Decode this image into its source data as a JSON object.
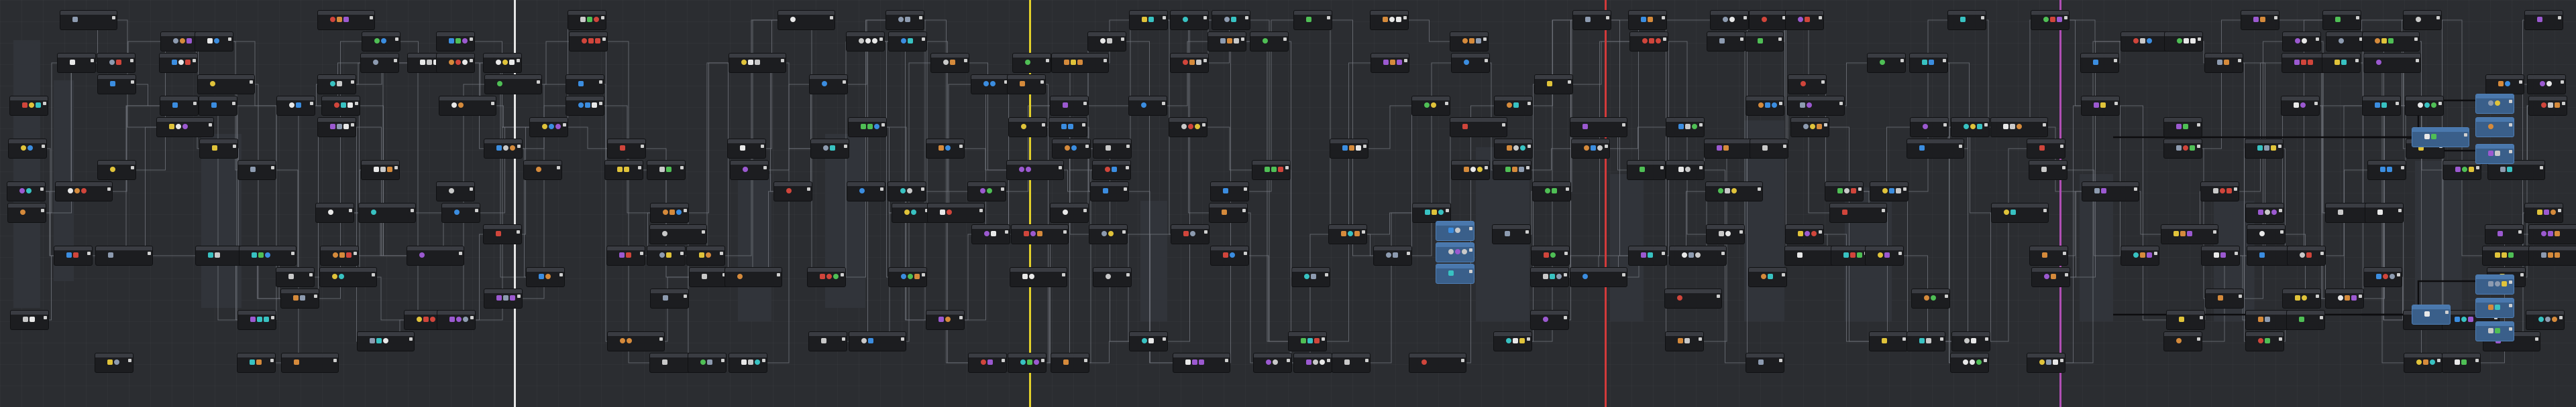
{
  "app": {
    "title": ""
  },
  "colors": {
    "background": "#2b2d31",
    "node": "#1c1d20",
    "node_selected": "#3a5f8a",
    "edge": "#7a7e86",
    "divider_white": "#e6e6e6",
    "divider_yellow": "#e3d12a",
    "divider_red": "#d23a3a",
    "divider_magenta": "#b04fb4"
  },
  "tech_tree": {
    "tier_dividers": [
      {
        "name": "tier-divider-white",
        "color": "#e6e6e6"
      },
      {
        "name": "tier-divider-yellow",
        "color": "#e3d12a"
      },
      {
        "name": "tier-divider-red",
        "color": "#d23a3a"
      },
      {
        "name": "tier-divider-magenta",
        "color": "#b04fb4"
      }
    ],
    "icon_palette": [
      {
        "name": "gear-icon",
        "color": "#c9c9c9"
      },
      {
        "name": "copper-ore-icon",
        "color": "#d58a3b"
      },
      {
        "name": "iron-ore-icon",
        "color": "#8d9bb0"
      },
      {
        "name": "circuit-icon",
        "color": "#4fbf55"
      },
      {
        "name": "blue-circuit-icon",
        "color": "#3b8de0"
      },
      {
        "name": "purple-science-icon",
        "color": "#9b59d0"
      },
      {
        "name": "yellow-science-icon",
        "color": "#e0c33a"
      },
      {
        "name": "red-item-icon",
        "color": "#d0453b"
      },
      {
        "name": "teal-item-icon",
        "color": "#38c2c2"
      },
      {
        "name": "white-item-icon",
        "color": "#e8e8e8"
      }
    ]
  }
}
